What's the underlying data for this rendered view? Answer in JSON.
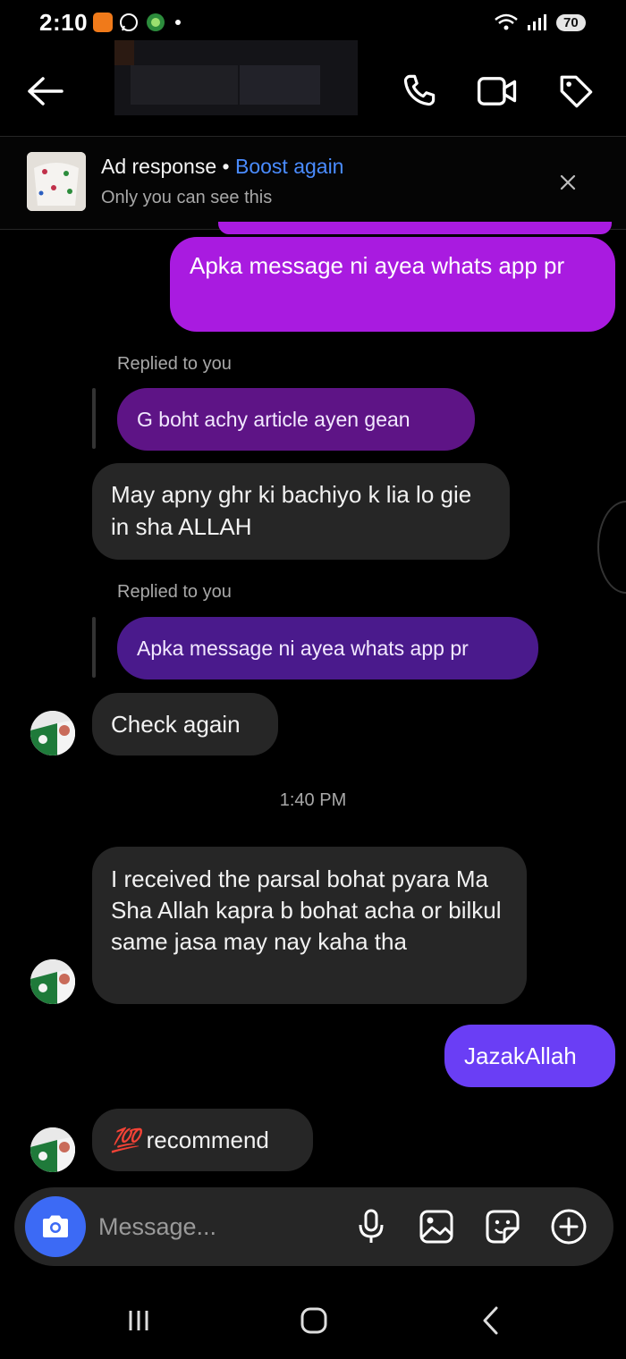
{
  "status_bar": {
    "time": "2:10",
    "battery": "70"
  },
  "header": {
    "icons": [
      "back-arrow-icon",
      "phone-icon",
      "video-icon",
      "tag-icon"
    ]
  },
  "ad_banner": {
    "title": "Ad response",
    "separator": " • ",
    "action": "Boost again",
    "subtitle": "Only you can see this"
  },
  "messages": {
    "m1": {
      "text": "Apka message  ni ayea whats app pr"
    },
    "r1_label": "Replied to you",
    "r1_quote": "G boht achy article  ayen gean",
    "m2": {
      "text": "May apny ghr ki bachiyo k lia lo gie in sha ALLAH"
    },
    "r2_label": "Replied to you",
    "r2_quote": "Apka message  ni ayea whats app pr",
    "m3": {
      "text": "Check again"
    },
    "time_sep": "1:40 PM",
    "m4": {
      "text": "I received the parsal bohat pyara Ma Sha Allah kapra b bohat acha or bilkul same jasa may nay kaha tha"
    },
    "m5": {
      "text": "JazakAllah"
    },
    "m6": {
      "emoji": "💯",
      "text": "recommend"
    }
  },
  "composer": {
    "placeholder": "Message..."
  },
  "colors": {
    "sent_magenta": "#a91be0",
    "sent_blue": "#6a3ef5",
    "received": "#262626",
    "link": "#4a8cff",
    "camera": "#3c6af5"
  }
}
